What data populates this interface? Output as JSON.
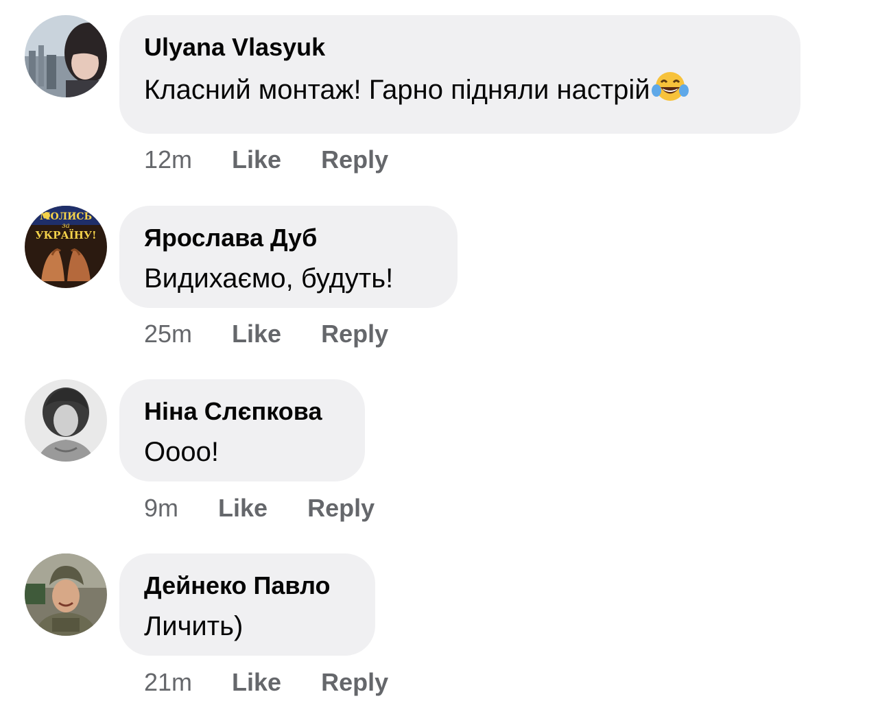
{
  "comments": [
    {
      "author": "Ulyana Vlasyuk",
      "text": "Класний монтаж! Гарно підняли настрій",
      "emoji": "face-with-tears-of-joy",
      "time": "12m",
      "like_label": "Like",
      "reply_label": "Reply"
    },
    {
      "author": "Ярослава Дуб",
      "text": "Видихаємо, будуть!",
      "time": "25m",
      "like_label": "Like",
      "reply_label": "Reply",
      "avatar_text": {
        "line1": "МОЛИСЬ",
        "line2": "за",
        "line3": "УКРАЇНУ!"
      }
    },
    {
      "author": "Ніна Слєпкова",
      "text": "Оооо!",
      "time": "9m",
      "like_label": "Like",
      "reply_label": "Reply"
    },
    {
      "author": "Дейнеко Павло",
      "text": "Личить)",
      "time": "21m",
      "like_label": "Like",
      "reply_label": "Reply"
    }
  ],
  "colors": {
    "bubble": "#f0f0f2",
    "meta": "#65676b",
    "text": "#050505"
  }
}
